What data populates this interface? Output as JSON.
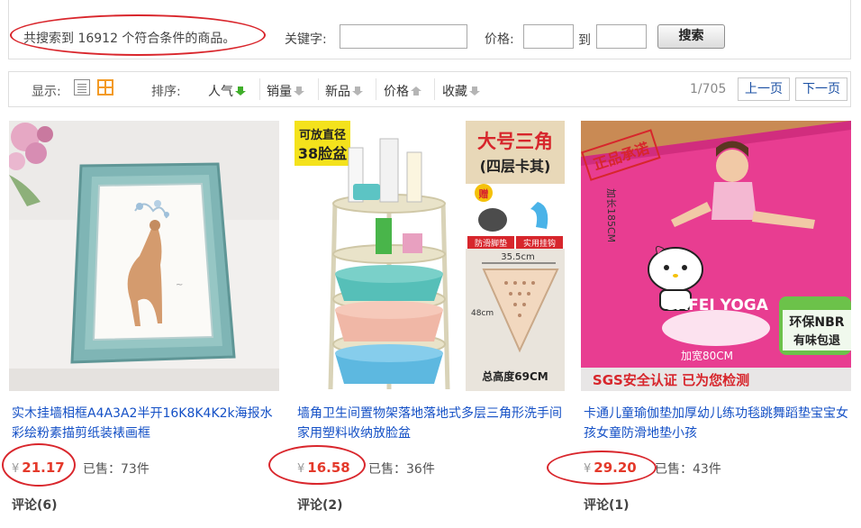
{
  "search": {
    "result_text": "共搜索到 16912 个符合条件的商品。",
    "keyword_label": "关键字:",
    "keyword_value": "",
    "price_label": "价格:",
    "price_min": "",
    "price_to": "到",
    "price_max": "",
    "button_label": "搜索"
  },
  "sortbar": {
    "display_label": "显示:",
    "sort_label": "排序:",
    "sort_options": [
      {
        "label": "人气",
        "arrow": "down-green"
      },
      {
        "label": "销量",
        "arrow": "down-gray"
      },
      {
        "label": "新品",
        "arrow": "down-gray"
      },
      {
        "label": "价格",
        "arrow": "up-gray"
      },
      {
        "label": "收藏",
        "arrow": "down-gray"
      }
    ],
    "page_info": "1/705",
    "prev_label": "上一页",
    "next_label": "下一页"
  },
  "products": [
    {
      "title": "实木挂墙相框A4A3A2半开16K8K4K2k海报水彩绘粉素描剪纸装裱画框",
      "currency": "¥",
      "price": "21.17",
      "sold": "已售：73件",
      "reviews": "评论(6)",
      "image": {
        "type": "picture-frame"
      }
    },
    {
      "title": "墙角卫生间置物架落地落地式多层三角形洗手间家用塑料收纳放脸盆",
      "currency": "¥",
      "price": "16.58",
      "sold": "已售：36件",
      "reviews": "评论(2)",
      "image": {
        "type": "corner-shelf",
        "badge_top": "可放直径",
        "badge_bottom": "38脸盆",
        "side_title": "大号三角",
        "side_sub": "(四层卡其)",
        "gift": "赠",
        "cap1": "防滑脚垫",
        "cap2": "实用挂钩",
        "dim_w": "35.5cm",
        "dim_h": "48cm",
        "total_h": "总高度69CM"
      }
    },
    {
      "title": "卡通儿童瑜伽垫加厚幼儿练功毯跳舞蹈垫宝宝女孩女童防滑地垫小孩",
      "currency": "¥",
      "price": "29.20",
      "sold": "已售：43件",
      "reviews": "评论(1)",
      "image": {
        "type": "yoga-mat",
        "stamp": "正品承诺",
        "length": "加长185CM",
        "brand": "GAFEI YOGA",
        "eco1": "环保NBR",
        "eco2": "有味包退",
        "width": "加宽80CM",
        "cert": "SGS安全认证 已为您检测"
      }
    }
  ],
  "colors": {
    "link": "#1450c6",
    "price": "#e4392a",
    "highlight": "#d9262c",
    "grid_icon": "#f39a24"
  }
}
